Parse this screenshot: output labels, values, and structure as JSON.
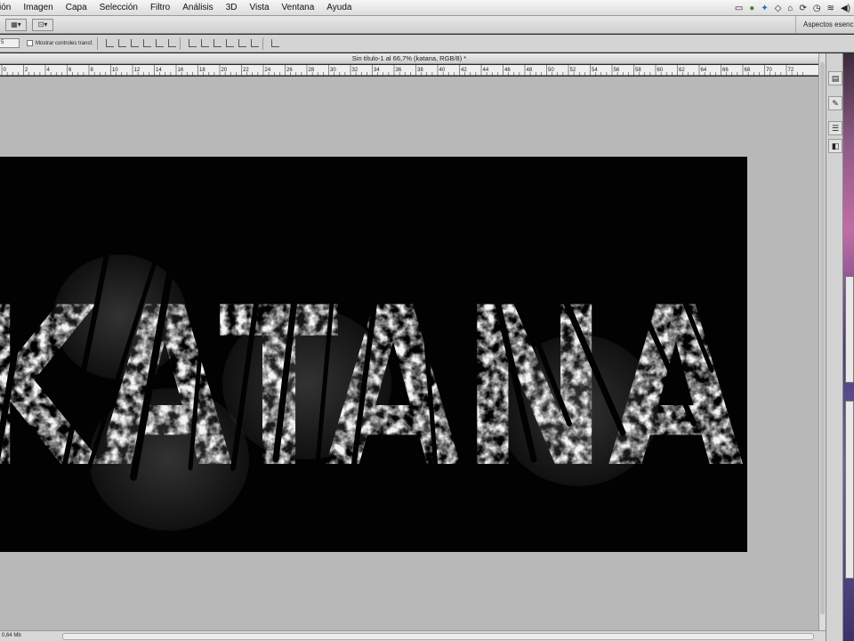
{
  "menubar": {
    "items": [
      "ción",
      "Imagen",
      "Capa",
      "Selección",
      "Filtro",
      "Análisis",
      "3D",
      "Vista",
      "Ventana",
      "Ayuda"
    ]
  },
  "appbar": {
    "workspace_label": "Aspectos esenc"
  },
  "options": {
    "size_value": "5",
    "transform_label": "Mostrar controles transf."
  },
  "document": {
    "title": "Sin título-1 al 66,7% (katana, RGB/8) *",
    "text": "KATANA",
    "background": "#020202",
    "text_color": "#f4f4f4"
  },
  "ruler": {
    "labels": [
      "0",
      "2",
      "4",
      "6",
      "8",
      "10",
      "12",
      "14",
      "16",
      "18",
      "20",
      "22",
      "24",
      "26",
      "28",
      "30",
      "32",
      "34",
      "36",
      "38",
      "40",
      "42",
      "44",
      "46",
      "48",
      "50",
      "52",
      "54",
      "56",
      "58",
      "60",
      "62",
      "64",
      "66",
      "68",
      "70",
      "72"
    ]
  },
  "statusbar": {
    "doc_size": "0,64 Mb"
  },
  "colors": {
    "canvas_gray": "#b8b8b8",
    "chrome_gray": "#d4d4d4"
  }
}
